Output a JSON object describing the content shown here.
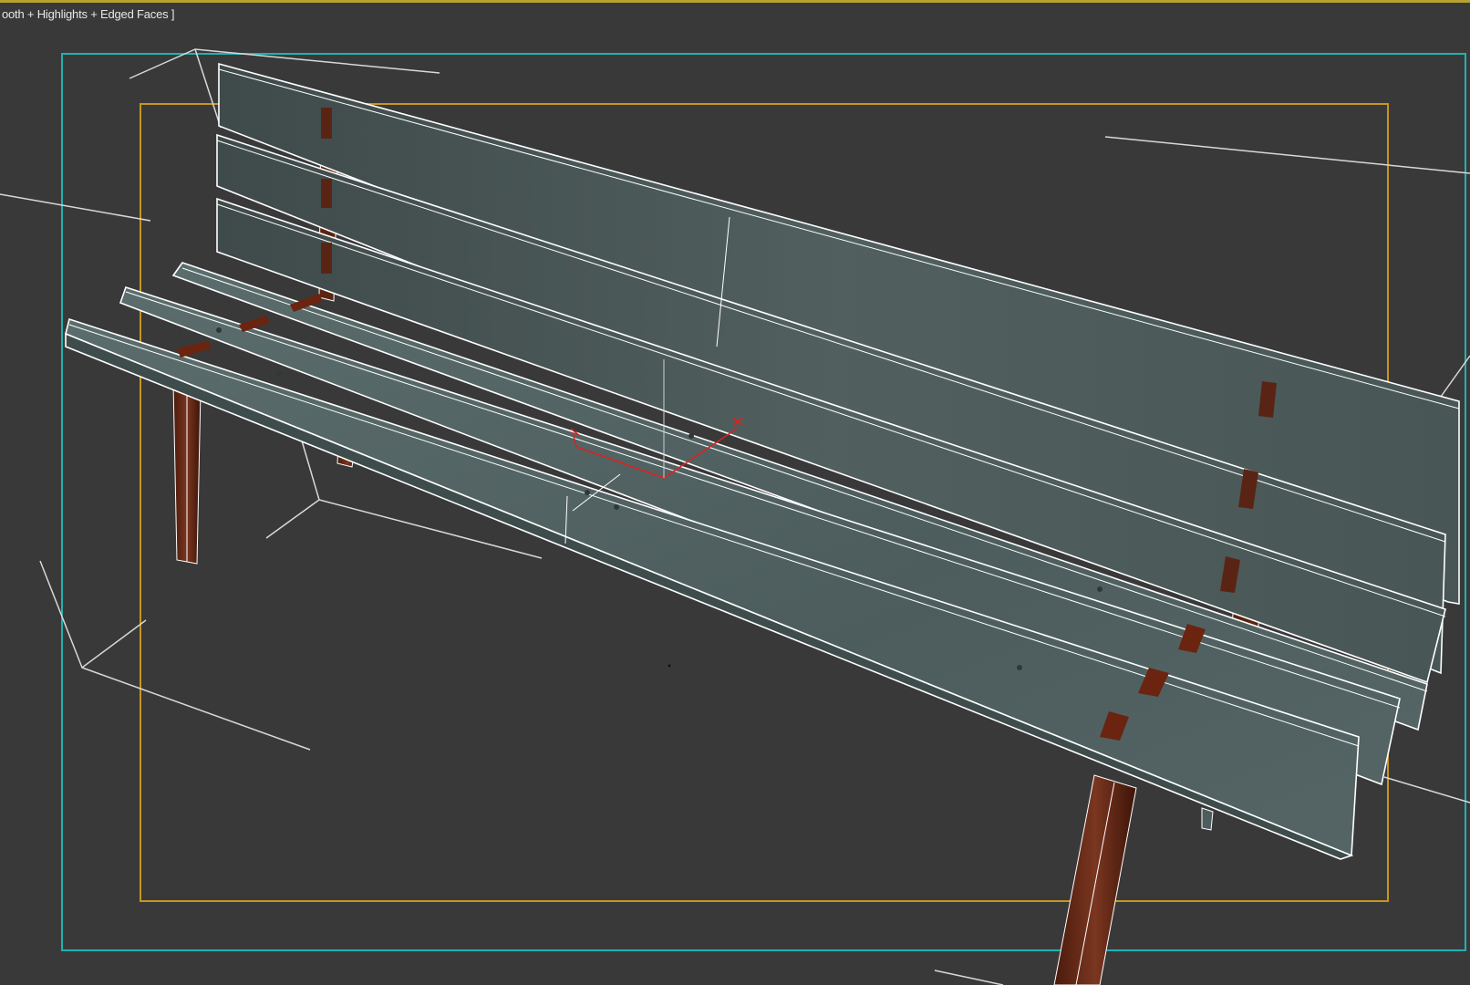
{
  "viewport": {
    "label": "ooth + Highlights + Edged Faces ]",
    "colors": {
      "background": "#393939",
      "active_border": "#b5a230",
      "camera_frame": "#1fb2b2",
      "safe_frame": "#c8961e",
      "wire": "#ffffff",
      "wood_plank": "#4e5e5e",
      "wood_plank_light": "#5f7070",
      "leg": "#6a2a14",
      "gizmo": "#e02020"
    }
  },
  "object": {
    "name_icon": "bench-mesh-icon",
    "seat_planks": 3,
    "back_planks": 3,
    "legs": 2
  }
}
